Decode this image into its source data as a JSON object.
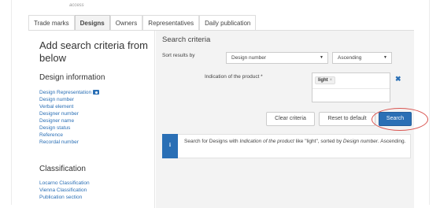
{
  "header": {
    "access_text": "access"
  },
  "tabs": [
    {
      "label": "Trade marks",
      "active": false
    },
    {
      "label": "Designs",
      "active": true
    },
    {
      "label": "Owners",
      "active": false
    },
    {
      "label": "Representatives",
      "active": false
    },
    {
      "label": "Daily publication",
      "active": false
    }
  ],
  "left": {
    "title": "Add search criteria from below",
    "design_info_title": "Design information",
    "design_info_links": [
      "Design Representation",
      "Design number",
      "Verbal element",
      "Designer number",
      "Designer name",
      "Design status",
      "Reference",
      "Recordal number"
    ],
    "classification_title": "Classification",
    "classification_links": [
      "Locarno Classification",
      "Vienna Classification",
      "Publication section"
    ]
  },
  "search": {
    "title": "Search criteria",
    "sort_label": "Sort results by",
    "sort_field": "Design number",
    "sort_order": "Ascending",
    "criterion_label": "Indication of the product *",
    "criterion_token": "light",
    "clear_label": "Clear criteria",
    "reset_label": "Reset to default",
    "search_label": "Search"
  },
  "info": {
    "icon": "info-icon",
    "text_prefix": "Search for Designs with ",
    "text_field": "Indication of the product",
    "text_middle": " like \"light\", sorted by ",
    "text_sort": "Design number",
    "text_suffix": ". Ascending."
  },
  "colors": {
    "accent": "#2a6fb5",
    "highlight_oval": "#d9534f"
  }
}
